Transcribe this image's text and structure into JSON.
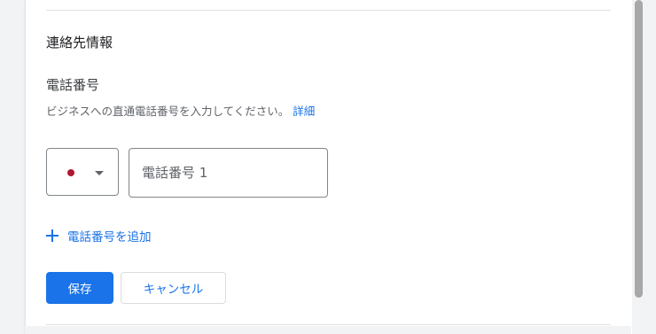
{
  "contact_section": {
    "title": "連絡先情報",
    "phone_label": "電話番号",
    "helper_text": "ビジネスへの直通電話番号を入力してください。",
    "helper_link": "詳細",
    "country_flag": "japan-flag-icon",
    "phone_placeholder": "電話番号 1",
    "phone_value": "",
    "add_phone_label": "電話番号を追加"
  },
  "actions": {
    "save_label": "保存",
    "cancel_label": "キャンセル"
  },
  "colors": {
    "accent": "#1a73e8",
    "flag_red": "#b0182e"
  }
}
